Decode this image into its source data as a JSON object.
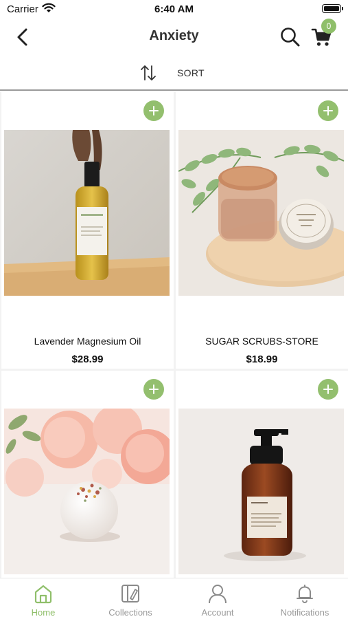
{
  "status_bar": {
    "carrier": "Carrier",
    "time": "6:40 AM"
  },
  "nav": {
    "title": "Anxiety",
    "cart_count": "0",
    "icons": {
      "back": "chevron-left-icon",
      "search": "search-icon",
      "cart": "cart-icon"
    }
  },
  "sort": {
    "label": "SORT",
    "icon": "sort-arrows-icon"
  },
  "products": [
    {
      "name": "Lavender Magnesium Oil",
      "price": "$28.99",
      "image": "oil-bottle-image"
    },
    {
      "name": "SUGAR SCRUBS-STORE",
      "price": "$18.99",
      "image": "sugar-scrub-jar-image"
    },
    {
      "name": "",
      "price": "",
      "image": "bath-bomb-with-peonies-image"
    },
    {
      "name": "",
      "price": "",
      "image": "amber-foaming-soap-bottle-image"
    }
  ],
  "tab_bar": {
    "tabs": [
      {
        "label": "Home",
        "icon": "home-icon",
        "active": true
      },
      {
        "label": "Collections",
        "icon": "collections-icon",
        "active": false
      },
      {
        "label": "Account",
        "icon": "account-icon",
        "active": false
      },
      {
        "label": "Notifications",
        "icon": "bell-icon",
        "active": false
      }
    ]
  },
  "colors": {
    "accent": "#8fbf6a",
    "tab_inactive": "#9a9a9a",
    "divider": "#9a9a9a"
  }
}
